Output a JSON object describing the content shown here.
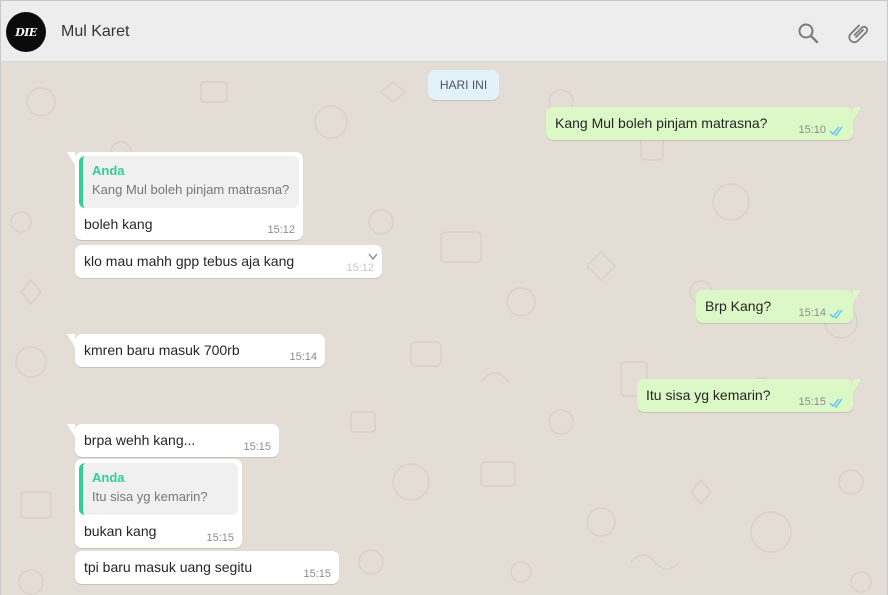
{
  "header": {
    "avatar_text": "DIE",
    "contact_name": "Mul Karet"
  },
  "chat": {
    "date_label": "HARI INI",
    "messages": [
      {
        "dir": "out",
        "text": "Kang Mul boleh pinjam matrasna?",
        "time": "15:10",
        "status": "read"
      },
      {
        "dir": "in",
        "quote_author": "Anda",
        "quote_text": "Kang Mul boleh pinjam matrasna?",
        "text": "boleh kang",
        "time": "15:12"
      },
      {
        "dir": "in",
        "text": "klo mau mahh gpp tebus aja kang",
        "time": "15:12"
      },
      {
        "dir": "out",
        "text": "Brp Kang?",
        "time": "15:14",
        "status": "read"
      },
      {
        "dir": "in",
        "text": "kmren baru masuk 700rb",
        "time": "15:14"
      },
      {
        "dir": "out",
        "text": "Itu sisa yg kemarin?",
        "time": "15:15",
        "status": "read"
      },
      {
        "dir": "in",
        "text": "brpa wehh kang...",
        "time": "15:15"
      },
      {
        "dir": "in",
        "quote_author": "Anda",
        "quote_text": "Itu sisa yg kemarin?",
        "text": "bukan kang",
        "time": "15:15"
      },
      {
        "dir": "in",
        "text": "tpi baru masuk uang segitu",
        "time": "15:15"
      }
    ]
  },
  "colors": {
    "incoming_bubble": "#ffffff",
    "outgoing_bubble": "#dcf8c6",
    "quote_accent": "#35cd96",
    "read_tick": "#4fc3f7",
    "wallpaper": "#e4ddd5"
  },
  "icons": {
    "search": "search-icon",
    "attach": "paperclip-icon",
    "read_receipt": "double-check-icon",
    "menu": "chevron-down-icon"
  }
}
